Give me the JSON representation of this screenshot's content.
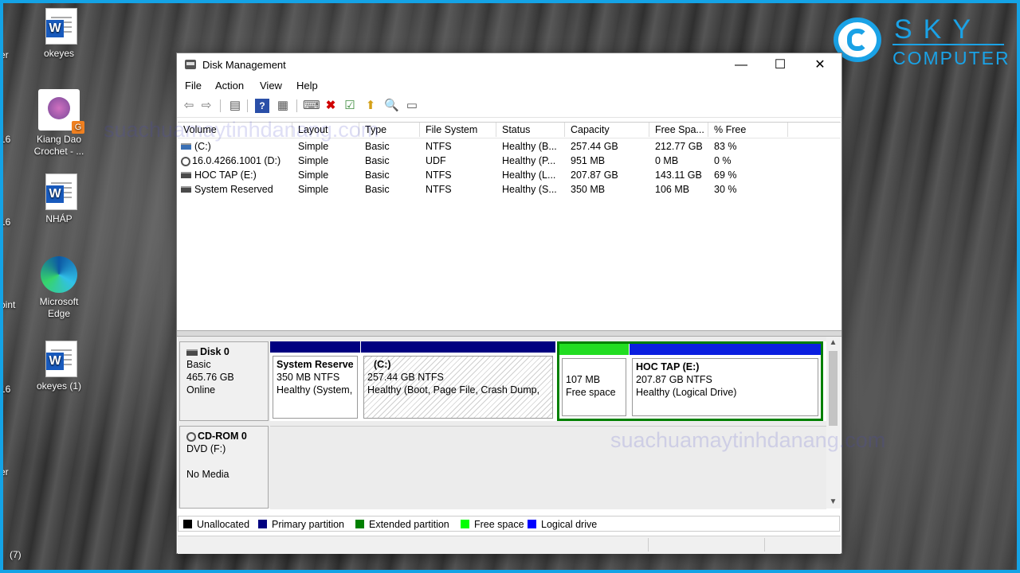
{
  "desktop": {
    "icons": [
      {
        "label": "okeyes"
      },
      {
        "label": "Kiang Dao Crochet - ..."
      },
      {
        "label": "NHÁP"
      },
      {
        "label": "Microsoft Edge"
      },
      {
        "label": "okeyes (1)"
      }
    ],
    "edge_fragments": [
      "er",
      "16",
      "16",
      "16",
      "oint",
      "16",
      "er",
      "(7)"
    ]
  },
  "logo": {
    "line1": "SKY",
    "line2": "COMPUTER"
  },
  "watermark": {
    "text1": "suachuamaytinhdanang.com",
    "text2": "suachuamaytinhdanang.com"
  },
  "window": {
    "title": "Disk Management",
    "controls": {
      "minimize": "—",
      "maximize": "☐",
      "close": "✕"
    },
    "menu": [
      "File",
      "Action",
      "View",
      "Help"
    ],
    "toolbar_icons": [
      "back-icon",
      "forward-icon",
      "console-tree-icon",
      "help-icon",
      "properties-icon",
      "connect-icon",
      "delete-icon",
      "check-icon",
      "up-folder-icon",
      "search-folder-icon",
      "settings-icon"
    ],
    "columns": [
      "Volume",
      "Layout",
      "Type",
      "File System",
      "Status",
      "Capacity",
      "Free Spa...",
      "% Free"
    ],
    "volumes": [
      {
        "volume": "(C:)",
        "layout": "Simple",
        "type": "Basic",
        "fs": "NTFS",
        "status": "Healthy (B...",
        "capacity": "257.44 GB",
        "free": "212.77 GB",
        "pct": "83 %"
      },
      {
        "volume": "16.0.4266.1001 (D:)",
        "layout": "Simple",
        "type": "Basic",
        "fs": "UDF",
        "status": "Healthy (P...",
        "capacity": "951 MB",
        "free": "0 MB",
        "pct": "0 %"
      },
      {
        "volume": "HOC TAP (E:)",
        "layout": "Simple",
        "type": "Basic",
        "fs": "NTFS",
        "status": "Healthy (L...",
        "capacity": "207.87 GB",
        "free": "143.11 GB",
        "pct": "69 %"
      },
      {
        "volume": "System Reserved",
        "layout": "Simple",
        "type": "Basic",
        "fs": "NTFS",
        "status": "Healthy (S...",
        "capacity": "350 MB",
        "free": "106 MB",
        "pct": "30 %"
      }
    ],
    "disks": [
      {
        "name": "Disk 0",
        "type": "Basic",
        "size": "465.76 GB",
        "state": "Online"
      },
      {
        "name": "CD-ROM 0",
        "type": "DVD (F:)",
        "size": "",
        "state": "No Media"
      }
    ],
    "partitions": [
      {
        "name": "System Reserve",
        "size": "350 MB NTFS",
        "status": "Healthy (System,"
      },
      {
        "name": "(C:)",
        "size": "257.44 GB NTFS",
        "status": "Healthy (Boot, Page File, Crash Dump,"
      },
      {
        "name": "",
        "size": "107 MB",
        "status": "Free space"
      },
      {
        "name": "HOC TAP  (E:)",
        "size": "207.87 GB NTFS",
        "status": "Healthy (Logical Drive)"
      }
    ],
    "legend": [
      {
        "label": "Unallocated",
        "color": "#000000"
      },
      {
        "label": "Primary partition",
        "color": "#000080"
      },
      {
        "label": "Extended partition",
        "color": "#008000"
      },
      {
        "label": "Free space",
        "color": "#00ff00"
      },
      {
        "label": "Logical drive",
        "color": "#0000ff"
      }
    ],
    "colors": {
      "primary": "#000080",
      "extended": "#008000",
      "free": "#22dd22",
      "logical": "#0b1fe0",
      "frame": "#14a3e6"
    }
  }
}
